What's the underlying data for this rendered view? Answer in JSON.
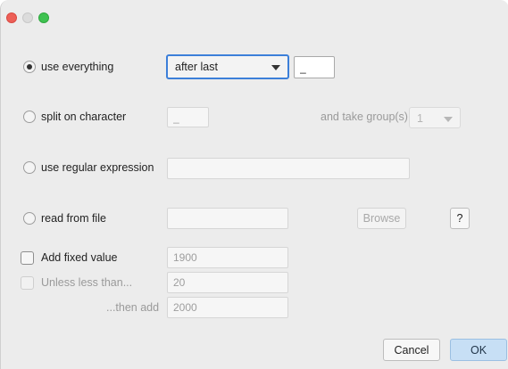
{
  "options": {
    "use_everything": "use everything",
    "split_on_character": "split on character",
    "use_regular_expression": "use regular expression",
    "read_from_file": "read from file"
  },
  "position_select": {
    "value": "after last"
  },
  "use_everything_char": "_",
  "split_char": "_",
  "take_groups": {
    "label": "and take group(s):",
    "value": "1"
  },
  "regex_value": "",
  "file_path_value": "",
  "browse_label": "Browse",
  "help_label": "?",
  "add_fixed": {
    "label": "Add fixed value",
    "value": "1900"
  },
  "unless_less": {
    "label": "Unless less than...",
    "value": "20"
  },
  "then_add": {
    "label": "...then add",
    "value": "2000"
  },
  "buttons": {
    "cancel": "Cancel",
    "ok": "OK"
  },
  "colors": {
    "accent": "#3c7fd9",
    "close": "#ed5f57",
    "maximize": "#3fc251",
    "ok_bg": "#c7dff5"
  }
}
